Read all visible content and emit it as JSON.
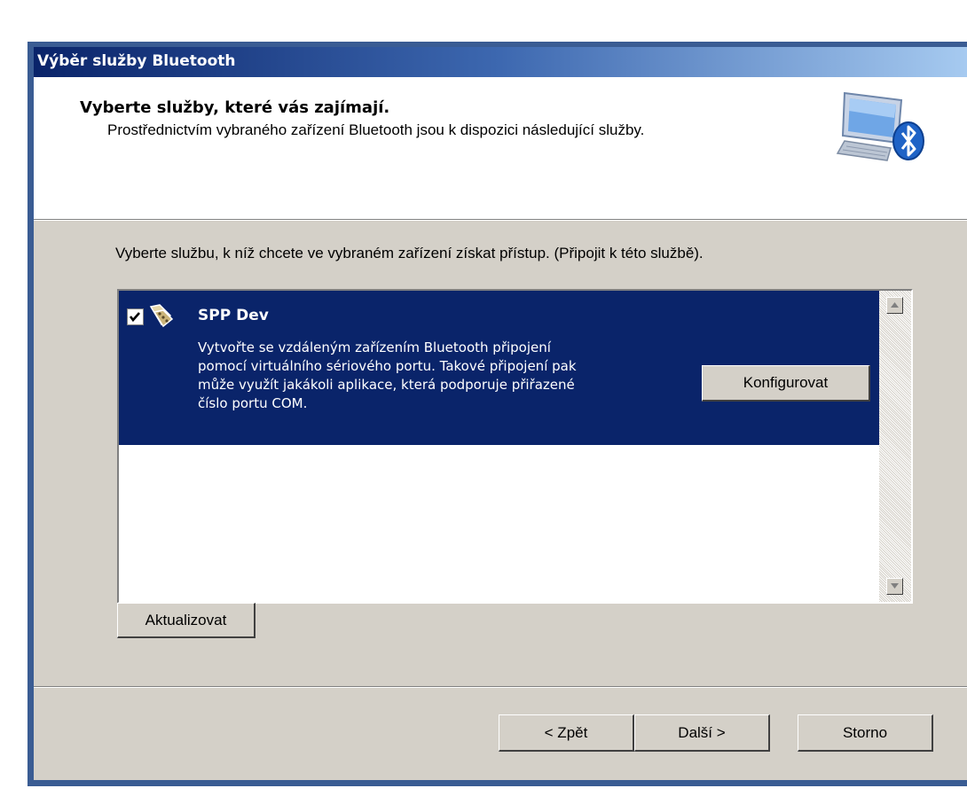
{
  "window": {
    "title": "Výběr služby Bluetooth"
  },
  "header": {
    "title": "Vyberte služby, které vás zajímají.",
    "subtitle": "Prostřednictvím vybraného zařízení Bluetooth jsou k dispozici následující služby.",
    "icon": "bluetooth-computer-icon"
  },
  "main": {
    "instruction": "Vyberte službu, k níž chcete ve vybraném zařízení získat přístup. (Připojit k této službě).",
    "services": [
      {
        "checked": true,
        "icon": "serial-port-icon",
        "name": "SPP Dev",
        "description_lines": [
          "Vytvořte se vzdáleným zařízením Bluetooth připojení",
          "pomocí virtuálního sériového portu. Takové připojení pak",
          "může využít jakákoli aplikace, která podporuje přiřazené",
          "číslo portu COM."
        ],
        "configure_label": "Konfigurovat"
      }
    ],
    "refresh_label": "Aktualizovat"
  },
  "footer": {
    "back_label": "< Zpět",
    "next_label": "Další >",
    "cancel_label": "Storno"
  },
  "colors": {
    "selection": "#0a246a",
    "dialog_face": "#d4d0c8",
    "frame": "#3a5c93"
  }
}
